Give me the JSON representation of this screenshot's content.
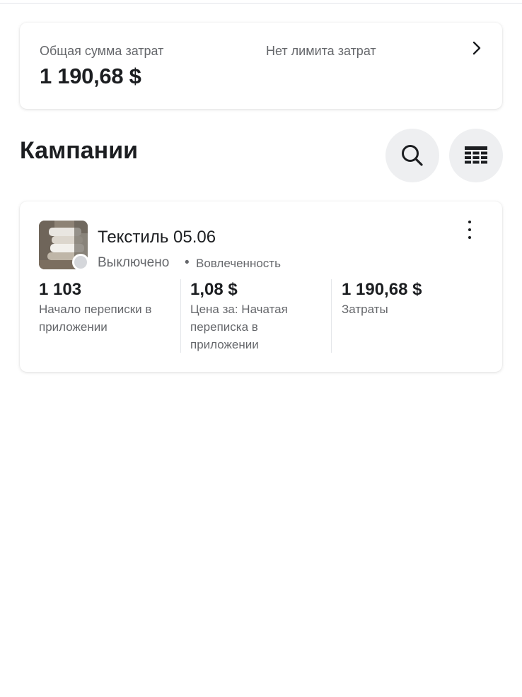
{
  "spend_summary": {
    "total_label": "Общая сумма затрат",
    "total_amount": "1 190,68 $",
    "limit_label": "Нет лимита затрат",
    "chevron_icon": "chevron-right-icon"
  },
  "campaigns_section": {
    "title": "Кампании",
    "search_icon": "search-icon",
    "columns_icon": "table-icon"
  },
  "campaign": {
    "name": "Текстиль 05.06",
    "status": "Выключено",
    "separator": "•",
    "objective": "Вовлеченность",
    "status_color": "#d5d7db",
    "metrics": [
      {
        "value": "1 103",
        "label": "Начало переписки в приложении"
      },
      {
        "value": "1,08 $",
        "label": "Цена за: Начатая переписка в приложении"
      },
      {
        "value": "1 190,68 $",
        "label": "Затраты"
      }
    ]
  }
}
